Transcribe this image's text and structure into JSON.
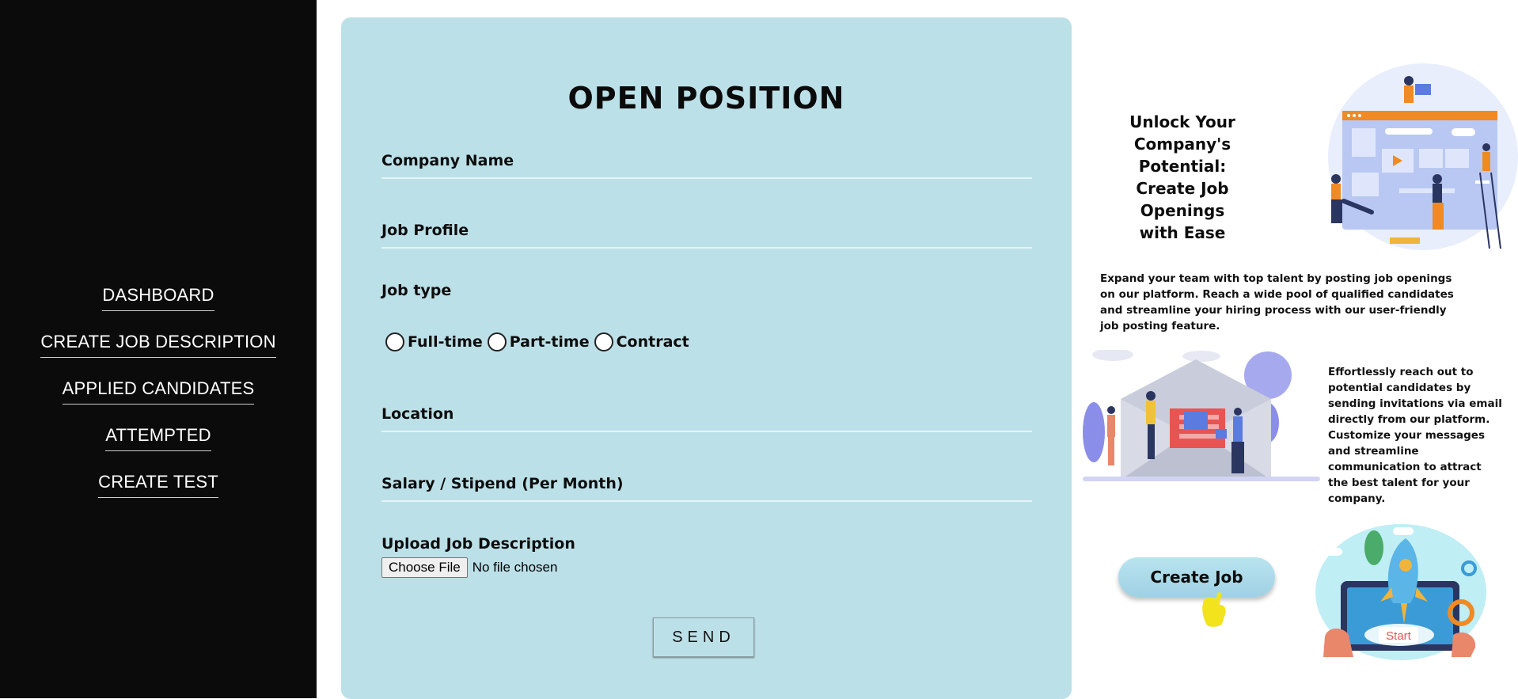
{
  "sidebar": {
    "items": [
      {
        "label": "DASHBOARD"
      },
      {
        "label": "CREATE JOB DESCRIPTION"
      },
      {
        "label": "APPLIED CANDIDATES"
      },
      {
        "label": "ATTEMPTED"
      },
      {
        "label": "CREATE TEST"
      }
    ]
  },
  "form": {
    "title": "OPEN POSITION",
    "company_label": "Company Name",
    "profile_label": "Job Profile",
    "jobtype_label": "Job type",
    "jobtype_options": [
      "Full-time",
      "Part-time",
      "Contract"
    ],
    "location_label": "Location",
    "salary_label": "Salary / Stipend (Per Month)",
    "upload_label": "Upload Job Description",
    "file_button": "Choose File",
    "file_status": "No file chosen",
    "send_label": "SEND"
  },
  "promo": {
    "heading_line1": "Unlock Your Company's",
    "heading_line2": "Potential:",
    "heading_line3": "Create Job Openings",
    "heading_line4": "with Ease",
    "paragraph1": "Expand your team with top talent by posting job openings on our platform. Reach a wide pool of qualified candidates and streamline your hiring process with our user-friendly job posting feature.",
    "paragraph2": "Effortlessly reach out to potential candidates by sending invitations via email directly from our platform. Customize your messages and streamline communication to attract the best talent for your company.",
    "create_job_label": "Create Job",
    "start_label": "Start"
  },
  "colors": {
    "sidebar_bg": "#0b0b0b",
    "card_bg": "#bce0e8",
    "accent_orange": "#f08a24",
    "illus_purple": "#8b8ee8"
  }
}
